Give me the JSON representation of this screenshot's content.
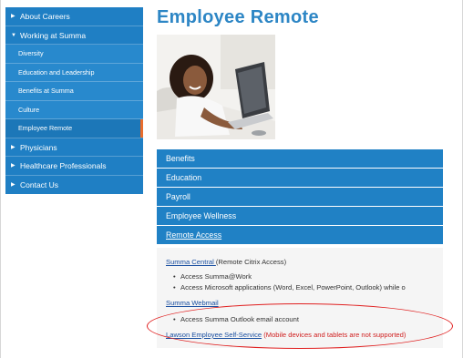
{
  "sidebar": {
    "items": [
      {
        "label": "About Careers",
        "caret": "▶"
      },
      {
        "label": "Working at Summa",
        "caret": "▼"
      },
      {
        "label": "Diversity"
      },
      {
        "label": "Education and Leadership"
      },
      {
        "label": "Benefits at Summa"
      },
      {
        "label": "Culture"
      },
      {
        "label": "Employee Remote"
      },
      {
        "label": "Physicians",
        "caret": "▶"
      },
      {
        "label": "Healthcare Professionals",
        "caret": "▶"
      },
      {
        "label": "Contact Us",
        "caret": "▶"
      }
    ]
  },
  "main": {
    "title": "Employee Remote",
    "accordion": [
      "Benefits",
      "Education",
      "Payroll",
      "Employee Wellness",
      "Remote Access"
    ],
    "content": {
      "citrix_link": "Summa Central ",
      "citrix_note": "(Remote Citrix Access)",
      "bullet1": "Access Summa@Work",
      "bullet2": "Access Microsoft applications (Word, Excel, PowerPoint, Outlook) while o",
      "webmail_link": "Summa Webmail",
      "bullet3": "Access Summa Outlook email account",
      "lawson_link": "Lawson Employee Self-Service",
      "lawson_note": " (Mobile devices and tablets are not supported)"
    }
  },
  "colors": {
    "sidebar": "#1f7fc4",
    "active_marker": "#e96d2c",
    "title": "#2d86c5",
    "accordion": "#2081c5",
    "annotation": "#e02020"
  }
}
